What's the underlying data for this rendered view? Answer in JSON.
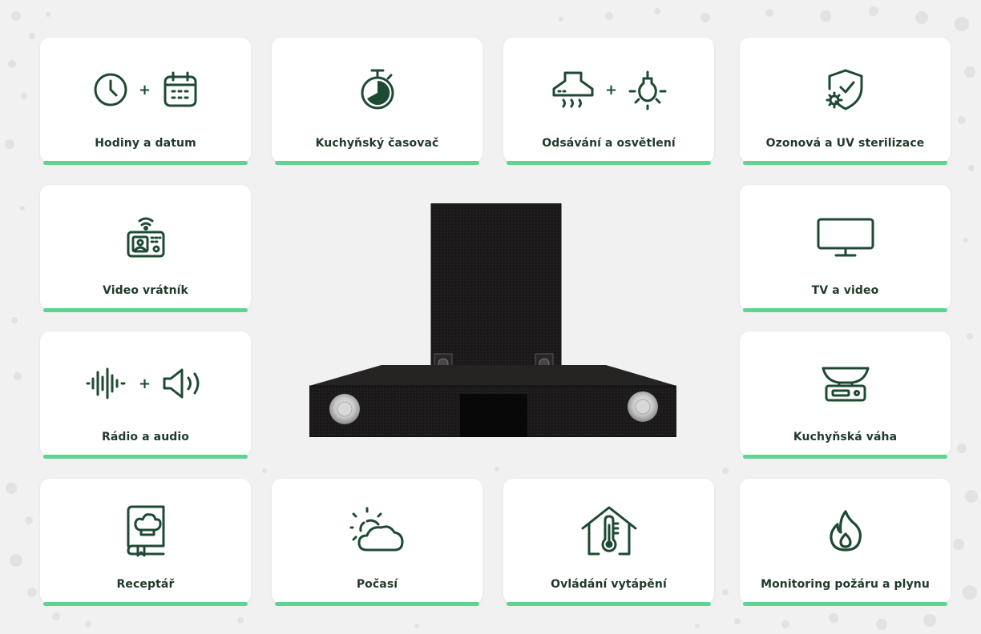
{
  "features": {
    "clock_date": "Hodiny a datum",
    "kitchen_timer": "Kuchyňský časovač",
    "extraction_lighting": "Odsávání a osvětlení",
    "ozone_uv": "Ozonová a UV sterilizace",
    "video_doorman": "Video vrátník",
    "tv_video": "TV a video",
    "radio_audio": "Rádio a audio",
    "kitchen_scale": "Kuchyňská váha",
    "recipes": "Receptář",
    "weather": "Počasí",
    "heating_control": "Ovládání vytápění",
    "fire_gas": "Monitoring požáru a plynu"
  },
  "plus_sign": "+",
  "colors": {
    "icon": "#1e4a33",
    "label": "#1f3a2b",
    "accent": "#5ed493",
    "card": "#ffffff",
    "background": "#f1f1f1"
  },
  "icons": {
    "clock_date": [
      "clock-icon",
      "calendar-icon"
    ],
    "kitchen_timer": [
      "stopwatch-icon"
    ],
    "extraction_lighting": [
      "range-hood-icon",
      "light-bulb-icon"
    ],
    "ozone_uv": [
      "shield-gear-icon"
    ],
    "video_doorman": [
      "intercom-icon"
    ],
    "tv_video": [
      "tv-icon"
    ],
    "radio_audio": [
      "sound-wave-icon",
      "speaker-icon"
    ],
    "kitchen_scale": [
      "scale-icon"
    ],
    "recipes": [
      "cookbook-icon"
    ],
    "weather": [
      "weather-icon"
    ],
    "heating_control": [
      "house-thermometer-icon"
    ],
    "fire_gas": [
      "flame-icon"
    ]
  }
}
